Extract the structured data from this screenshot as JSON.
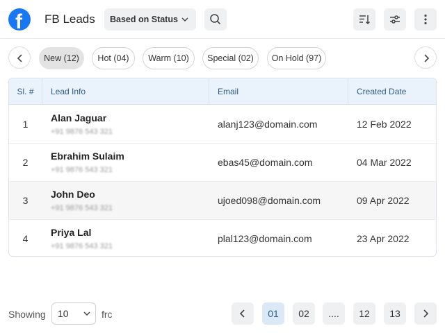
{
  "header": {
    "title": "FB Leads",
    "status_filter": "Based on Status",
    "logo_letter": "f",
    "brand_color": "#1877f2"
  },
  "tabs": [
    {
      "label": "New (12)",
      "active": true
    },
    {
      "label": "Hot (04)"
    },
    {
      "label": "Warm (10)"
    },
    {
      "label": "Special (02)"
    },
    {
      "label": "On Hold (97)"
    }
  ],
  "table": {
    "columns": [
      "Sl. #",
      "Lead Info",
      "Email",
      "Created Date"
    ],
    "rows": [
      {
        "num": "1",
        "name": "Alan Jaguar",
        "phone": "+91 9876 543 321",
        "email": "alanj123@domain.com",
        "date": "12 Feb 2022"
      },
      {
        "num": "2",
        "name": "Ebrahim Sulaim",
        "phone": "+91 9876 543 321",
        "email": "ebas45@domain.com",
        "date": "04 Mar 2022"
      },
      {
        "num": "3",
        "name": "John Deo",
        "phone": "+91 9876 543 321",
        "email": "ujoed098@domain.com",
        "date": "09 Apr 2022"
      },
      {
        "num": "4",
        "name": "Priya Lal",
        "phone": "+91 9876 543 321",
        "email": "plal123@domain.com",
        "date": "23 Apr 2022"
      }
    ]
  },
  "footer": {
    "showing_label": "Showing",
    "page_size": "10",
    "from_text": "frc",
    "pages": [
      "01",
      "02",
      "....",
      "12",
      "13"
    ],
    "current_page": "01"
  },
  "icons": {
    "search": "search-icon",
    "sort": "sort-icon",
    "filter": "sliders-icon",
    "more": "more-vertical-icon"
  }
}
